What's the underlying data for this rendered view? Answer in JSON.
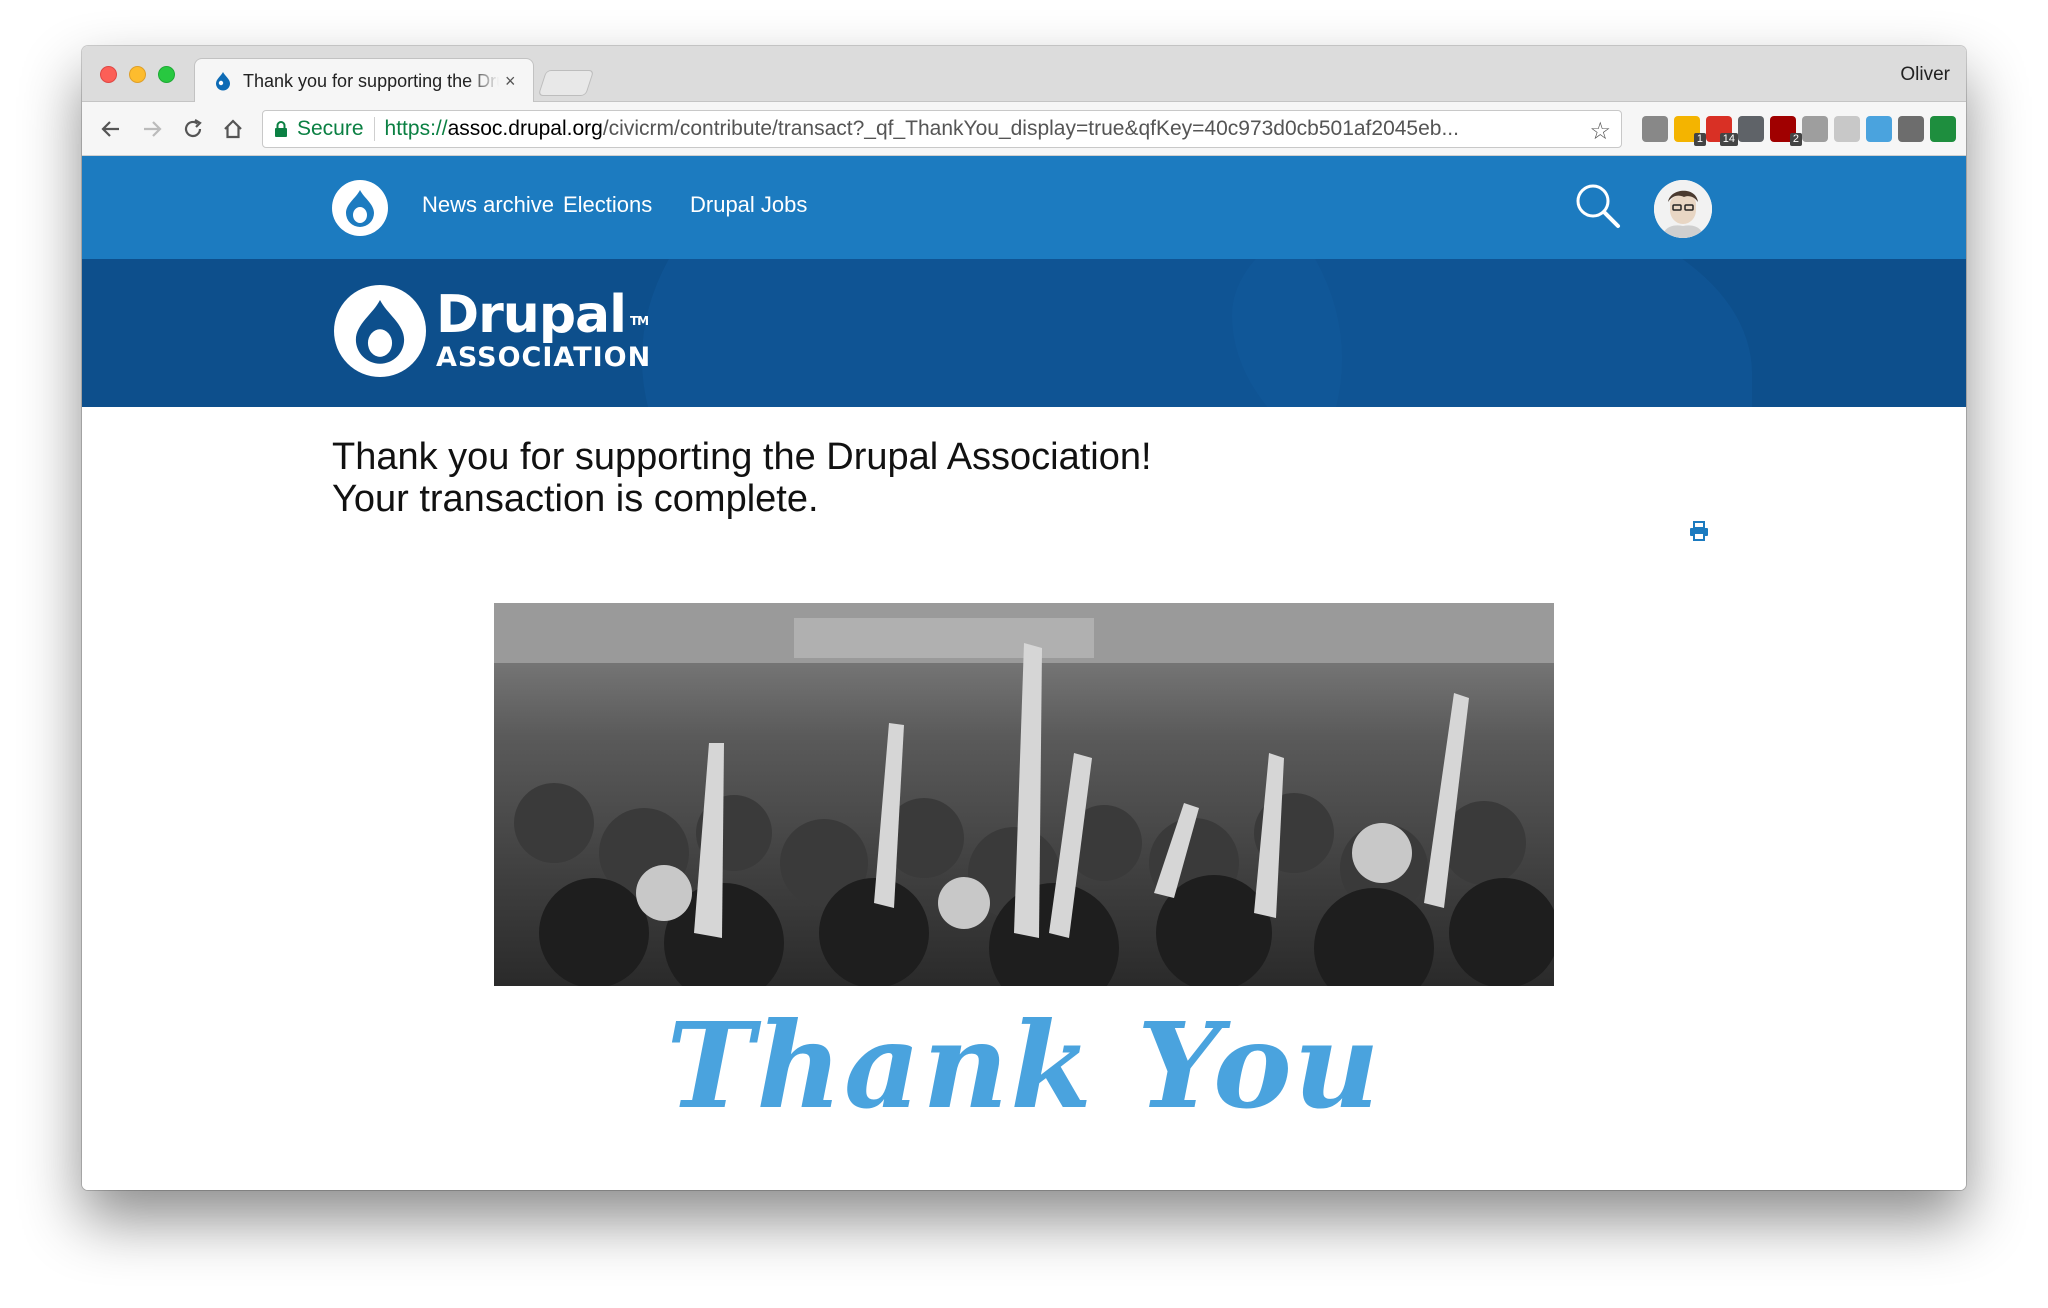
{
  "browser": {
    "tab_title": "Thank you for supporting the Drupal Association",
    "tab_close": "×",
    "profile_name": "Oliver",
    "secure_label": "Secure",
    "url_scheme": "https://",
    "url_host": "assoc.drupal.org",
    "url_path": "/civicrm/contribute/transact?_qf_ThankYou_display=true&qfKey=40c973d0cb501af2045eb...",
    "star": "☆",
    "extensions": [
      {
        "name": "gear-ext-icon",
        "color": "#888888",
        "badge": ""
      },
      {
        "name": "sticky-ext-icon",
        "color": "#f4b400",
        "badge": "1"
      },
      {
        "name": "calendar-ext-icon",
        "color": "#d93025",
        "badge": "14"
      },
      {
        "name": "settings-ext-icon",
        "color": "#5f6368",
        "badge": ""
      },
      {
        "name": "ublock-ext-icon",
        "color": "#a00000",
        "badge": "2"
      },
      {
        "name": "camera-ext-icon",
        "color": "#9e9e9e",
        "badge": ""
      },
      {
        "name": "drive-ext-icon",
        "color": "#c8c8c8",
        "badge": ""
      },
      {
        "name": "check-ext-icon",
        "color": "#4aa3de",
        "badge": ""
      },
      {
        "name": "play-ext-icon",
        "color": "#6d6d6d",
        "badge": ""
      },
      {
        "name": "upload-ext-icon",
        "color": "#1e8e3e",
        "badge": ""
      }
    ]
  },
  "site": {
    "nav": {
      "links": [
        "News archive",
        "Elections",
        "Drupal Jobs"
      ]
    },
    "brand": {
      "name": "Drupal",
      "tm": "TM",
      "sub": "ASSOCIATION"
    },
    "heading": {
      "line1": "Thank you for supporting the Drupal Association!",
      "line2": "Your transaction is complete."
    },
    "thanks_script": "Thank You",
    "colors": {
      "nav_blue": "#1c7bc0",
      "banner_blue": "#0d4f8c",
      "script_blue": "#4aa3de"
    }
  }
}
